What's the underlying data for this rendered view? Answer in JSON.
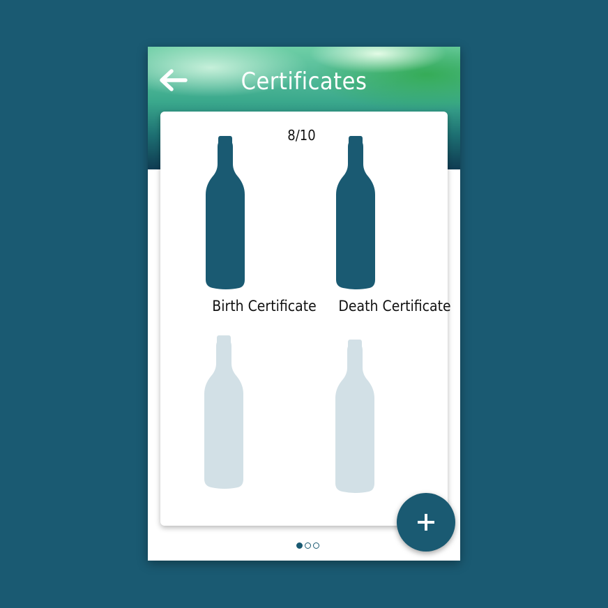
{
  "header": {
    "title": "Certificates",
    "back_icon": "arrow-left-icon"
  },
  "collection": {
    "counter": "8/10",
    "items": [
      {
        "label": "Birth Certificate",
        "icon": "bottle-icon",
        "state": "filled"
      },
      {
        "label": "Death Certificate",
        "icon": "bottle-icon",
        "state": "filled"
      },
      {
        "label": "",
        "icon": "bottle-icon",
        "state": "empty"
      },
      {
        "label": "",
        "icon": "bottle-icon",
        "state": "empty"
      }
    ]
  },
  "fab": {
    "icon": "plus-icon"
  },
  "pager": {
    "pages": 3,
    "current": 1
  },
  "colors": {
    "background": "#1a5a72",
    "bottle_filled": "#1a5a72",
    "bottle_empty": "#d2e0e6",
    "fab": "#1a5a72"
  }
}
